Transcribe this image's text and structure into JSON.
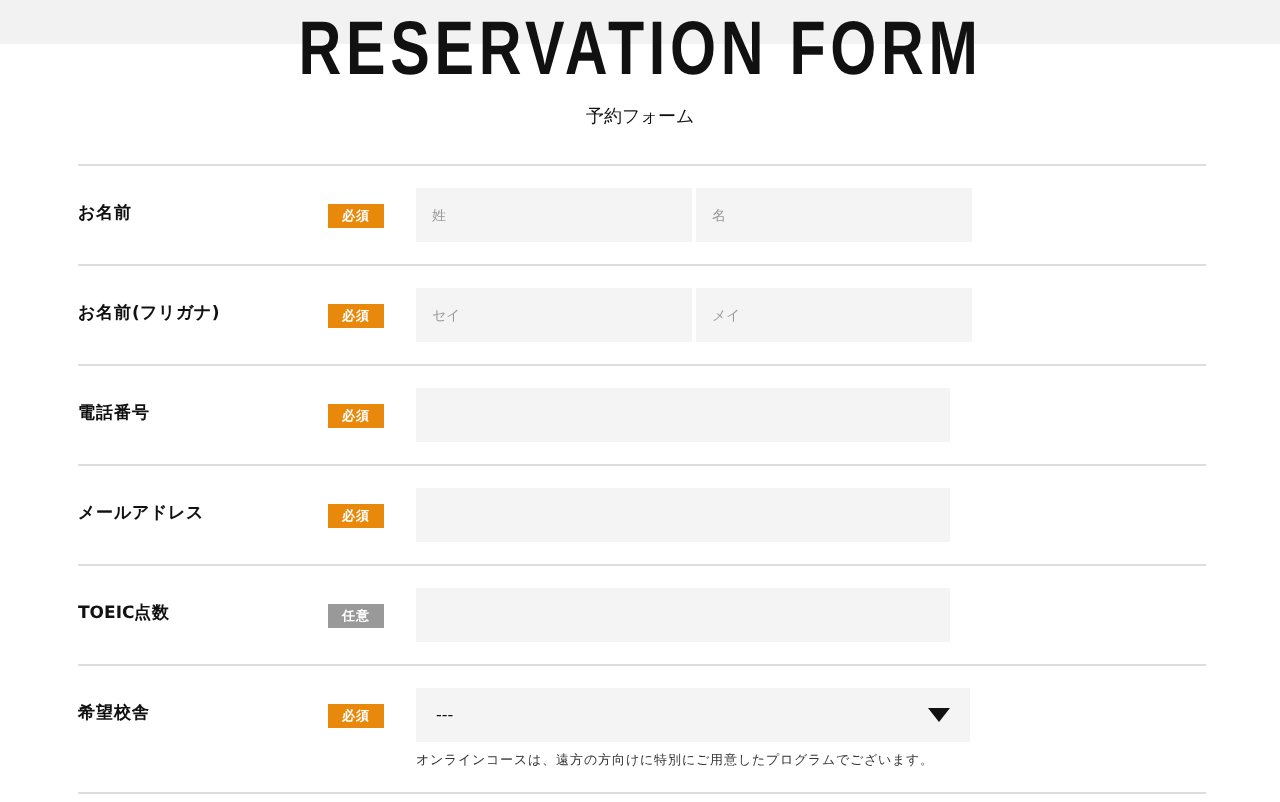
{
  "header": {
    "title": "RESERVATION FORM",
    "subtitle": "予約フォーム"
  },
  "rows": [
    {
      "kind": "split",
      "label": "お名前",
      "badge": "必須",
      "required": true,
      "placeholders": [
        "姓",
        "名"
      ]
    },
    {
      "kind": "split",
      "label": "お名前(フリガナ)",
      "badge": "必須",
      "required": true,
      "placeholders": [
        "セイ",
        "メイ"
      ]
    },
    {
      "kind": "text",
      "label": "電話番号",
      "badge": "必須",
      "required": true
    },
    {
      "kind": "text",
      "label": "メールアドレス",
      "badge": "必須",
      "required": true
    },
    {
      "kind": "text",
      "label": "TOEIC点数",
      "badge": "任意",
      "required": false
    },
    {
      "kind": "select",
      "label": "希望校舎",
      "badge": "必須",
      "required": true,
      "value": "---",
      "note": "オンラインコースは、遠方の方向けに特別にご用意したプログラムでございます。"
    }
  ]
}
